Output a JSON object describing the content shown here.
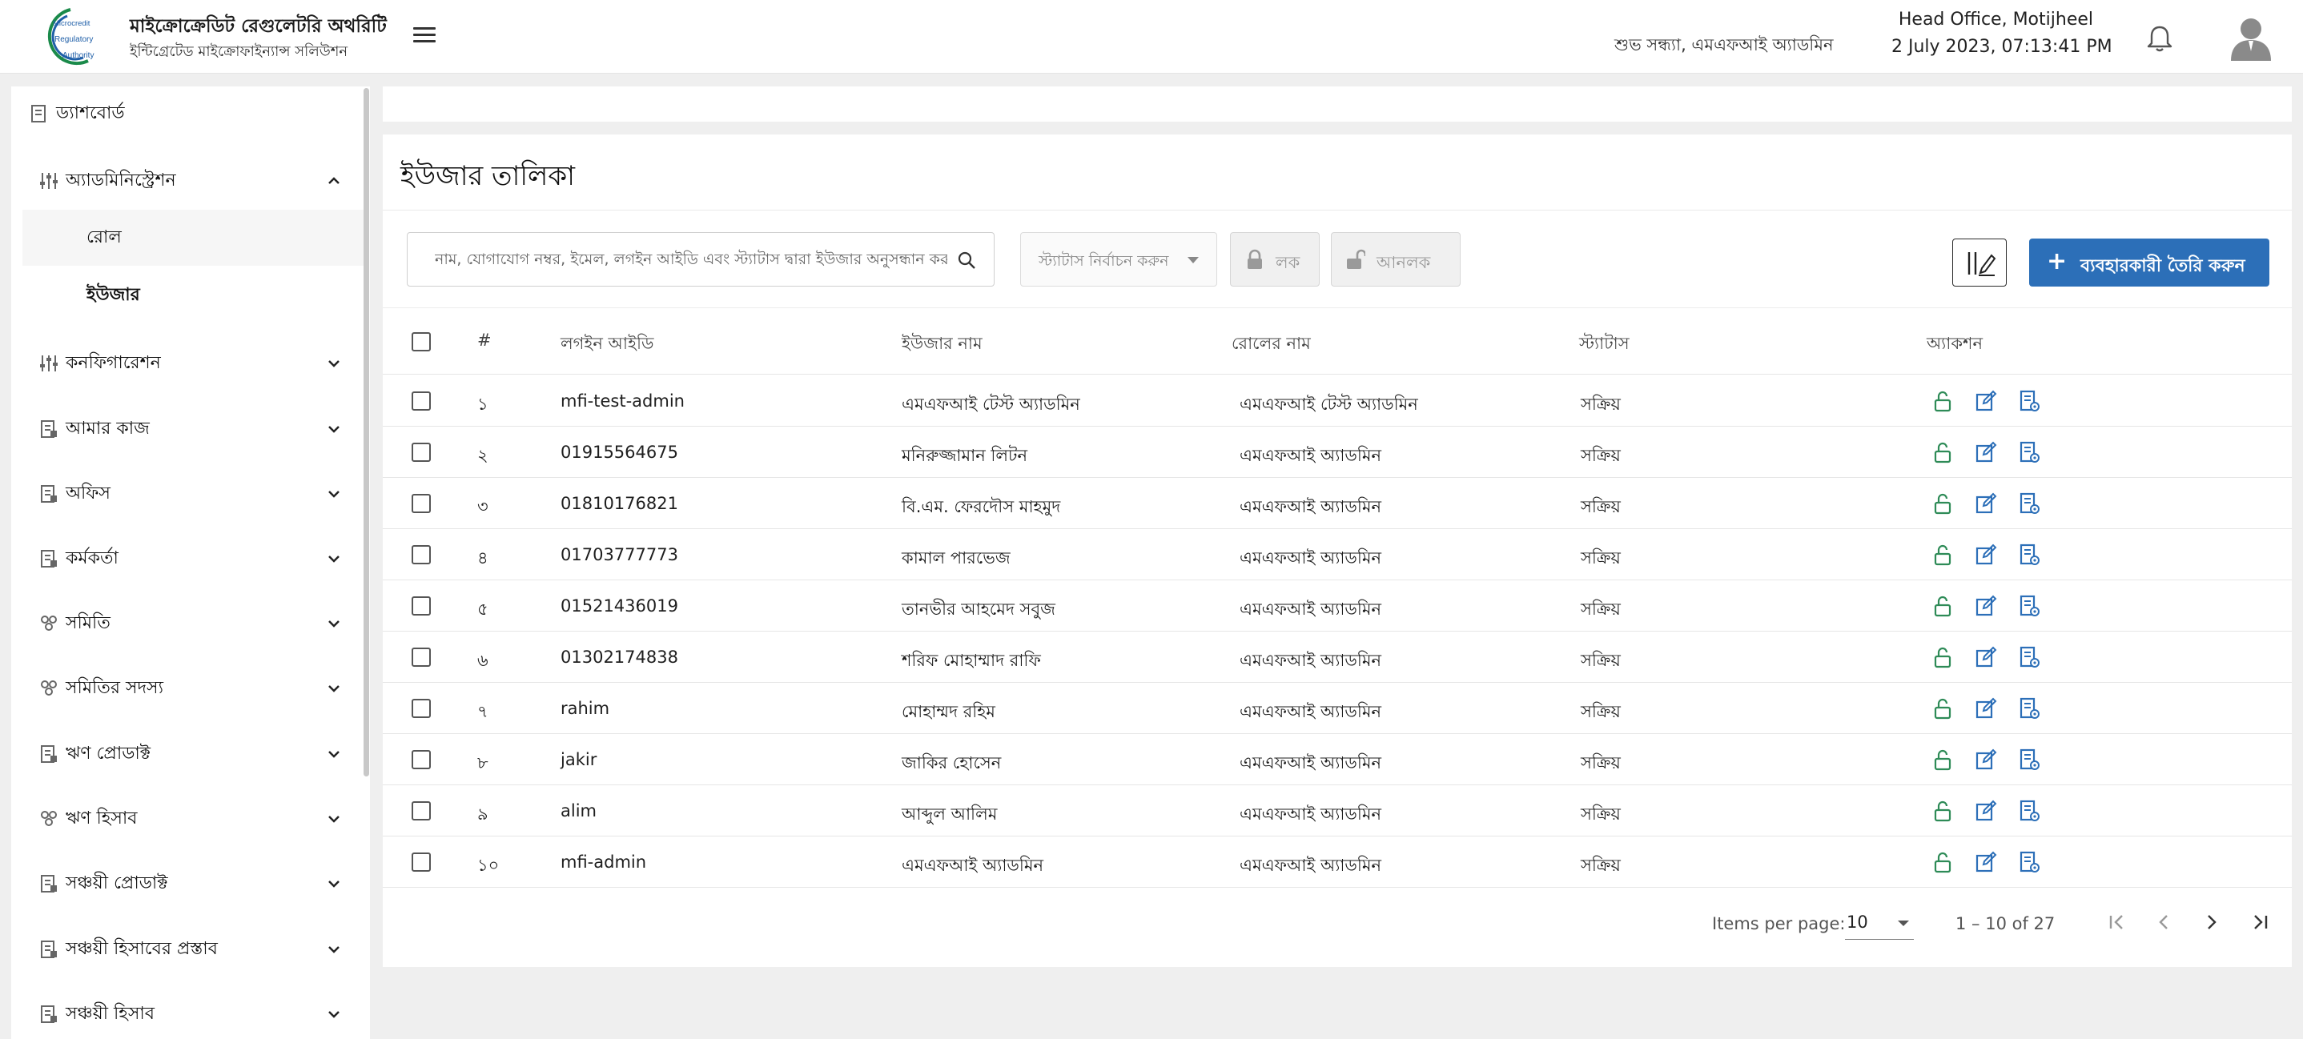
{
  "header": {
    "org_title": "মাইক্রোক্রেডিট রেগুলেটরি অথরিটি",
    "org_subtitle": "ইন্টিগ্রেটেড মাইক্রোফাইন্যান্স সলিউশন",
    "logo_text": [
      "Microcredit",
      "Regulatory",
      "Authority"
    ],
    "greeting": "শুভ সন্ধ্যা, এমএফআই অ্যাডমিন",
    "office": "Head Office, Motijheel",
    "datetime": "2 July 2023, 07:13:41 PM"
  },
  "sidebar": {
    "dashboard": "ড্যাশবোর্ড",
    "administration": "অ্যাডমিনিস্ট্রেশন",
    "sub_items": [
      "রোল",
      "ইউজার"
    ],
    "items": [
      "কনফিগারেশন",
      "আমার কাজ",
      "অফিস",
      "কর্মকর্তা",
      "সমিতি",
      "সমিতির সদস্য",
      "ঋণ প্রোডাক্ট",
      "ঋণ হিসাব",
      "সঞ্চয়ী প্রোডাক্ট",
      "সঞ্চয়ী হিসাবের প্রস্তাব",
      "সঞ্চয়ী হিসাব"
    ]
  },
  "main": {
    "title": "ইউজার তালিকা",
    "search_placeholder": "নাম, যোগাযোগ নম্বর, ইমেল, লগইন আইডি এবং স্ট্যাটাস দ্বারা ইউজার অনুসন্ধান করুন",
    "status_placeholder": "স্ট্যাটাস নির্বাচন করুন",
    "lock_label": "লক",
    "unlock_label": "আনলক",
    "create_label": "ব্যবহারকারী তৈরি করুন"
  },
  "table": {
    "headers": [
      "#",
      "লগইন আইডি",
      "ইউজার নাম",
      "রোলের নাম",
      "স্ট্যাটাস",
      "অ্যাকশন"
    ],
    "rows": [
      {
        "no": "১",
        "login": "mfi-test-admin",
        "name": "এমএফআই টেস্ট অ্যাডমিন",
        "role": "এমএফআই টেস্ট অ্যাডমিন",
        "status": "সক্রিয়"
      },
      {
        "no": "২",
        "login": "01915564675",
        "name": "মনিরুজ্জামান লিটন",
        "role": "এমএফআই অ্যাডমিন",
        "status": "সক্রিয়"
      },
      {
        "no": "৩",
        "login": "01810176821",
        "name": "বি.এম. ফেরদৌস মাহমুদ",
        "role": "এমএফআই অ্যাডমিন",
        "status": "সক্রিয়"
      },
      {
        "no": "৪",
        "login": "01703777773",
        "name": "কামাল পারভেজ",
        "role": "এমএফআই অ্যাডমিন",
        "status": "সক্রিয়"
      },
      {
        "no": "৫",
        "login": "01521436019",
        "name": "তানভীর আহমেদ সবুজ",
        "role": "এমএফআই অ্যাডমিন",
        "status": "সক্রিয়"
      },
      {
        "no": "৬",
        "login": "01302174838",
        "name": "শরিফ মোহাম্মাদ রাফি",
        "role": "এমএফআই অ্যাডমিন",
        "status": "সক্রিয়"
      },
      {
        "no": "৭",
        "login": "rahim",
        "name": "মোহাম্মদ রহিম",
        "role": "এমএফআই অ্যাডমিন",
        "status": "সক্রিয়"
      },
      {
        "no": "৮",
        "login": "jakir",
        "name": "জাকির হোসেন",
        "role": "এমএফআই অ্যাডমিন",
        "status": "সক্রিয়"
      },
      {
        "no": "৯",
        "login": "alim",
        "name": "আব্দুল আলিম",
        "role": "এমএফআই অ্যাডমিন",
        "status": "সক্রিয়"
      },
      {
        "no": "১০",
        "login": "mfi-admin",
        "name": "এমএফআই অ্যাডমিন",
        "role": "এমএফআই অ্যাডমিন",
        "status": "সক্রিয়"
      }
    ]
  },
  "paginator": {
    "items_per_page_label": "Items per page:",
    "page_size": "10",
    "range": "1 – 10 of 27"
  },
  "colors": {
    "primary": "#2c6fb8",
    "action_green": "#2e8b57",
    "action_blue": "#2c6fb8"
  },
  "icons": {
    "row_actions": [
      "unlock-icon",
      "edit-icon",
      "details-icon"
    ]
  }
}
